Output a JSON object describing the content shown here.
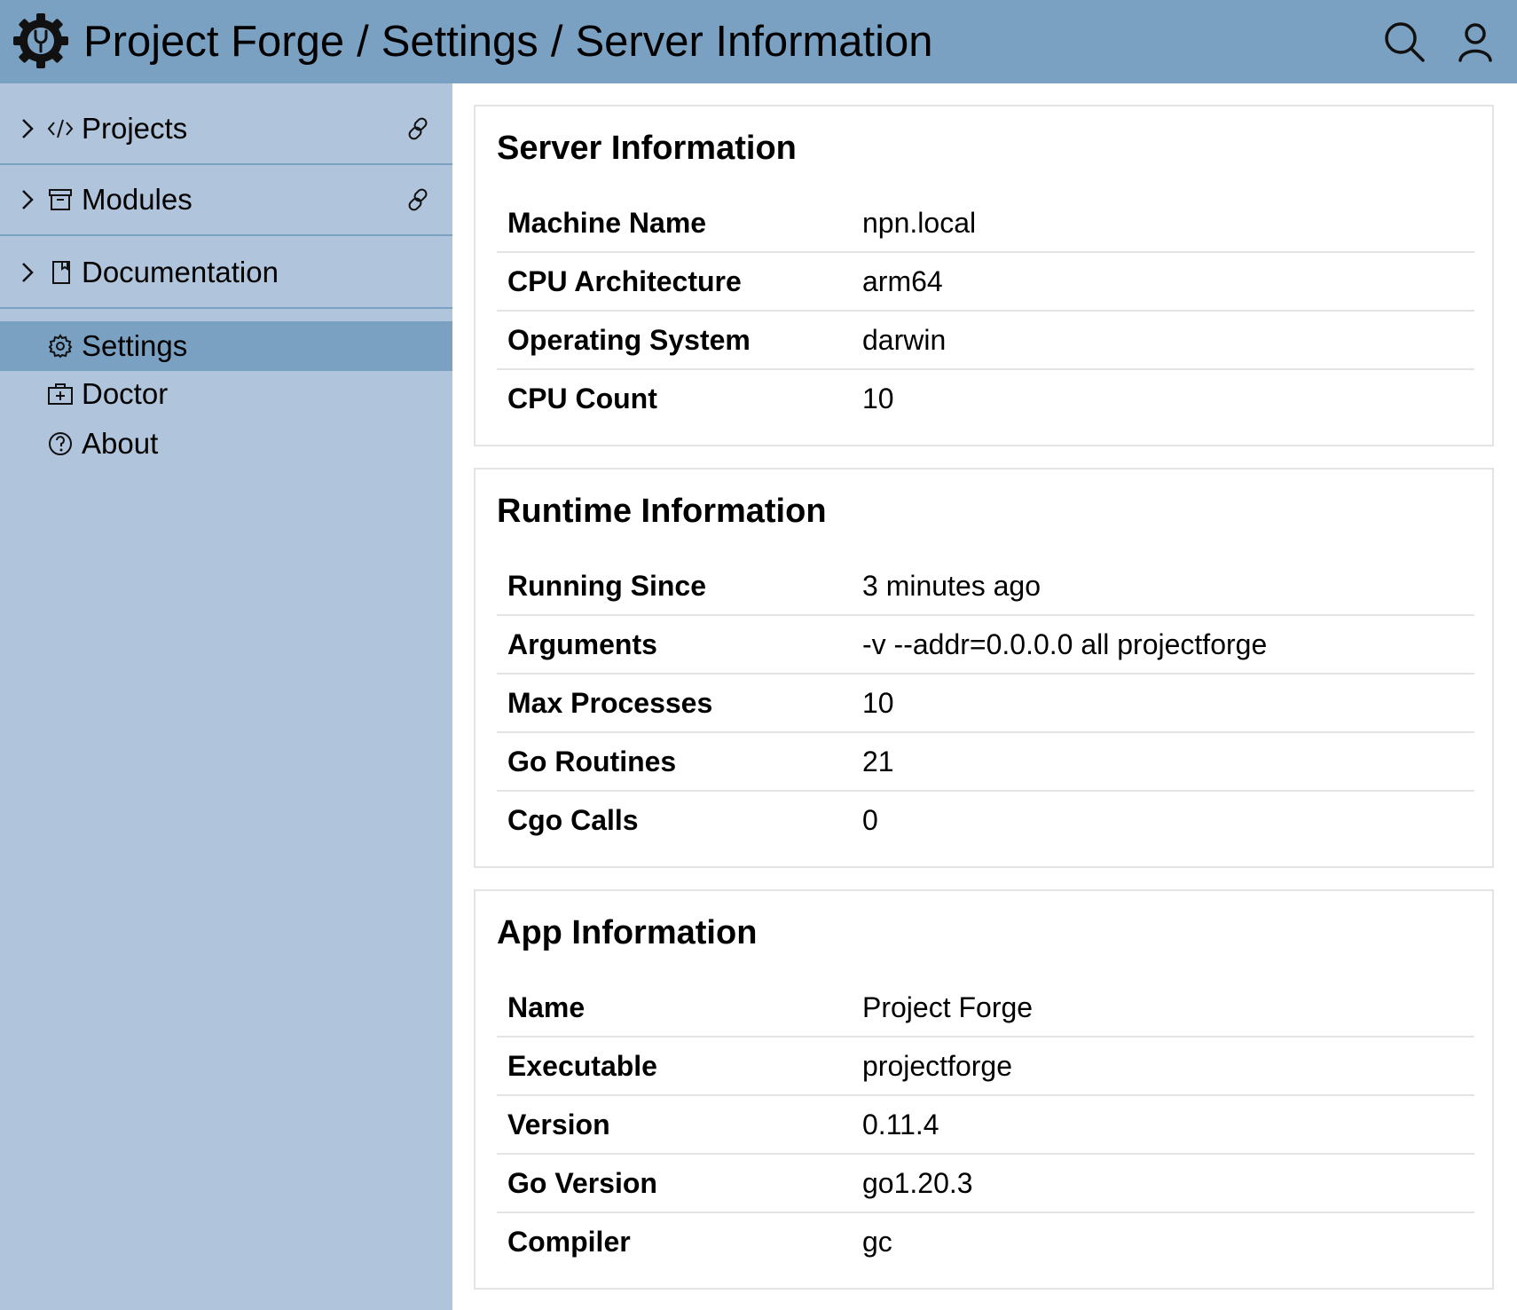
{
  "header": {
    "breadcrumb": [
      "Project Forge",
      "Settings",
      "Server Information"
    ],
    "separator": "/",
    "icons": [
      "gear-logo-icon",
      "search-icon",
      "user-icon"
    ],
    "color": "#7ba1c2"
  },
  "sidebar": {
    "color": "#b0c4dc",
    "active_color": "#7ba1c2",
    "sections": [
      {
        "label": "Projects",
        "icon": "code-icon",
        "linked": true
      },
      {
        "label": "Modules",
        "icon": "archive-icon",
        "linked": true
      },
      {
        "label": "Documentation",
        "icon": "book-icon",
        "linked": false
      }
    ],
    "items": [
      {
        "label": "Settings",
        "icon": "gear-icon",
        "active": true
      },
      {
        "label": "Doctor",
        "icon": "medkit-icon",
        "active": false
      },
      {
        "label": "About",
        "icon": "question-icon",
        "active": false
      }
    ]
  },
  "cards": [
    {
      "title": "Server Information",
      "rows": [
        {
          "key": "Machine Name",
          "value": "npn.local"
        },
        {
          "key": "CPU Architecture",
          "value": "arm64"
        },
        {
          "key": "Operating System",
          "value": "darwin"
        },
        {
          "key": "CPU Count",
          "value": "10"
        }
      ]
    },
    {
      "title": "Runtime Information",
      "rows": [
        {
          "key": "Running Since",
          "value": "3 minutes ago"
        },
        {
          "key": "Arguments",
          "value": "-v --addr=0.0.0.0 all projectforge"
        },
        {
          "key": "Max Processes",
          "value": "10"
        },
        {
          "key": "Go Routines",
          "value": "21"
        },
        {
          "key": "Cgo Calls",
          "value": "0"
        }
      ]
    },
    {
      "title": "App Information",
      "rows": [
        {
          "key": "Name",
          "value": "Project Forge"
        },
        {
          "key": "Executable",
          "value": "projectforge"
        },
        {
          "key": "Version",
          "value": "0.11.4"
        },
        {
          "key": "Go Version",
          "value": "go1.20.3"
        },
        {
          "key": "Compiler",
          "value": "gc"
        }
      ]
    }
  ]
}
